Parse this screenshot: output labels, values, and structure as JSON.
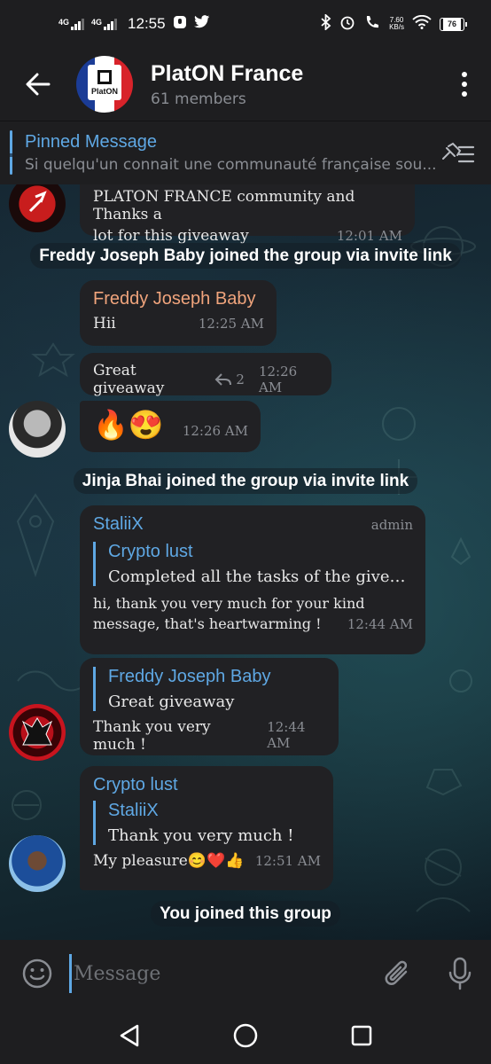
{
  "status_bar": {
    "network_1": "4G",
    "network_2": "4G",
    "time": "12:55",
    "speed_value": "7.60",
    "speed_unit": "KB/s",
    "battery": "76"
  },
  "header": {
    "title": "PlatON France",
    "members": "61 members",
    "avatar_text": "PlatON"
  },
  "pinned": {
    "title": "Pinned Message",
    "text": "Si quelqu'un connait une communauté française sou..."
  },
  "messages": {
    "m1": {
      "text_line1": "PLATON FRANCE community and Thanks a",
      "text_line2": "lot for this giveaway",
      "time": "12:01 AM"
    },
    "service1": "Freddy Joseph Baby joined the group via invite link",
    "m2": {
      "sender": "Freddy Joseph Baby",
      "text": "Hii",
      "time": "12:25 AM"
    },
    "m3": {
      "text": "Great giveaway",
      "reply_count": "2",
      "time": "12:26 AM"
    },
    "m4": {
      "emojis": "🔥😍",
      "time": "12:26 AM"
    },
    "service2": "Jinja Bhai joined the group via invite link",
    "m5": {
      "sender": "StaliiX",
      "badge": "admin",
      "reply_name": "Crypto lust",
      "reply_text": "Completed all the tasks of the giveawa...",
      "text_line1": "hi, thank you very much for your kind",
      "text_line2": "message, that's heartwarming !",
      "time": "12:44 AM"
    },
    "m6": {
      "reply_name": "Freddy Joseph Baby",
      "reply_text": "Great giveaway",
      "text": "Thank you very much !",
      "time": "12:44 AM"
    },
    "m7": {
      "sender": "Crypto lust",
      "reply_name": "StaliiX",
      "reply_text": "Thank you very much !",
      "text": "My pleasure😊❤️👍",
      "time": "12:51 AM"
    },
    "service3": "You joined this group"
  },
  "input": {
    "placeholder": "Message"
  },
  "colors": {
    "accent": "#5fa8e4",
    "sender_orange": "#f0a47c",
    "bubble": "#212124",
    "bar": "#1e1e20"
  },
  "icons": {
    "back": "arrow-left-icon",
    "menu": "more-vertical-icon",
    "pin_list": "pin-list-icon",
    "emoji": "smile-icon",
    "attach": "paperclip-icon",
    "mic": "microphone-icon",
    "reply": "reply-arrow-icon"
  }
}
